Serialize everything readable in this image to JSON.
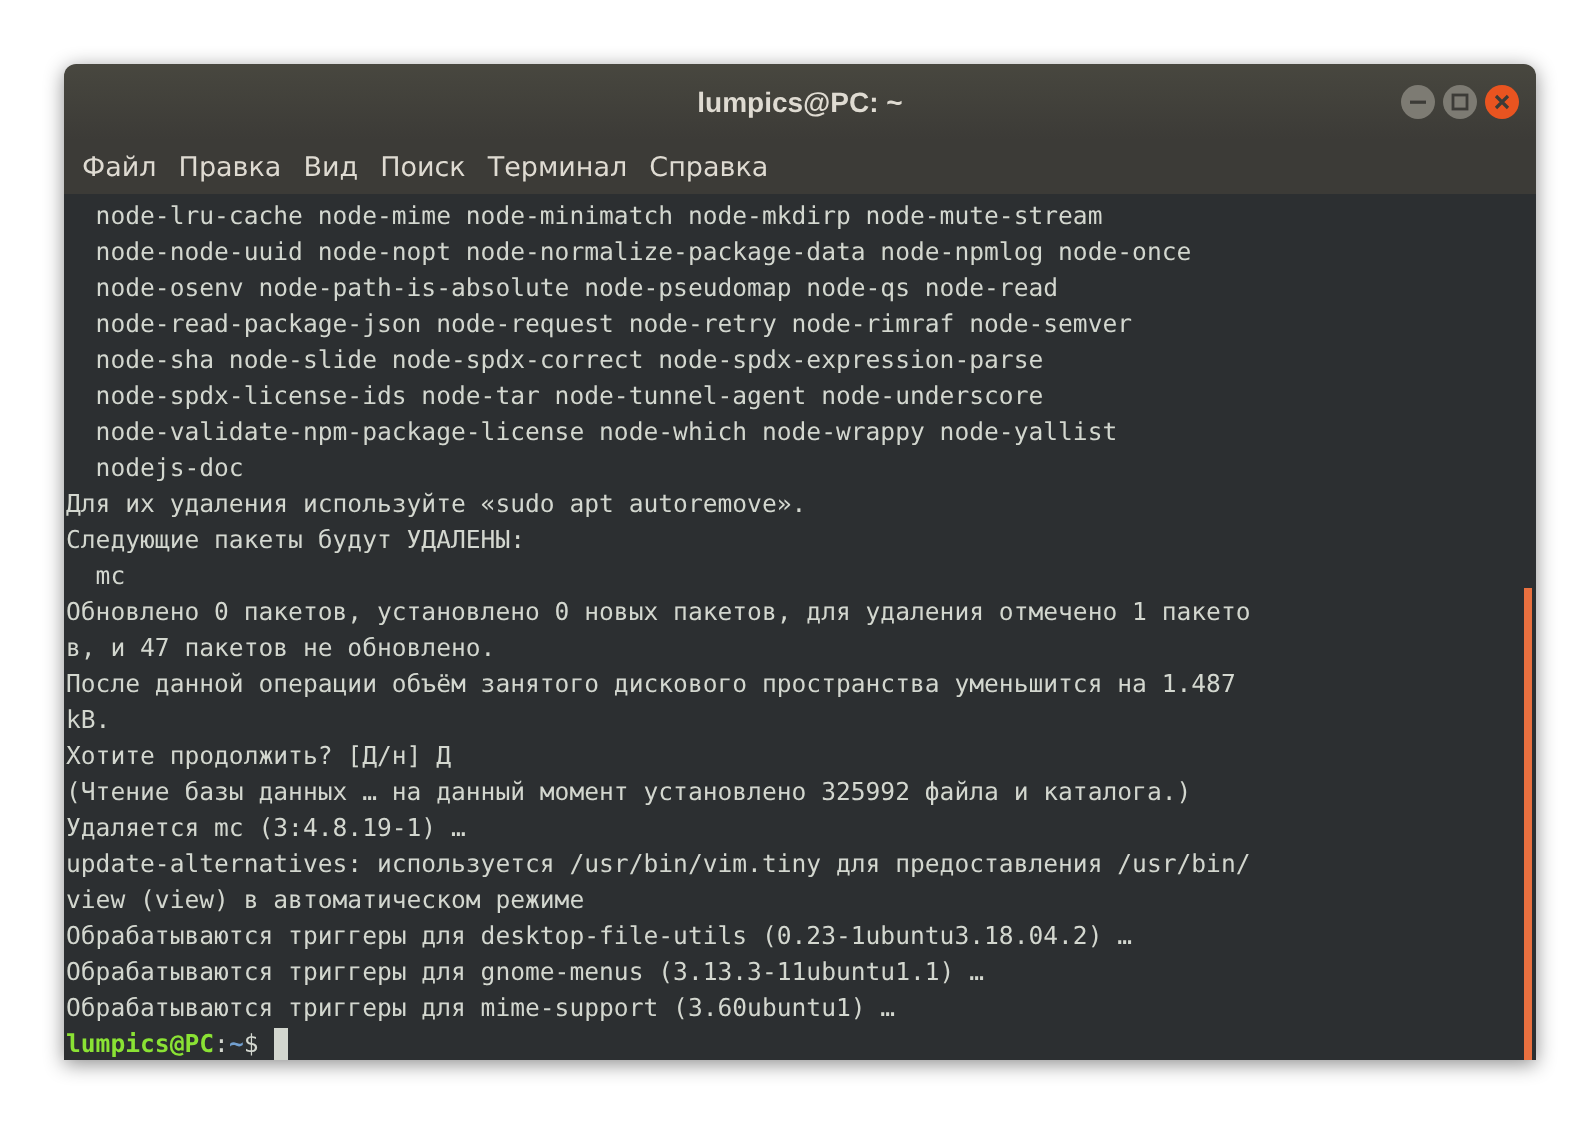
{
  "window": {
    "title": "lumpics@PC: ~"
  },
  "menu": [
    "Файл",
    "Правка",
    "Вид",
    "Поиск",
    "Терминал",
    "Справка"
  ],
  "terminal": {
    "lines": [
      {
        "kind": "text",
        "text": "  node-lru-cache node-mime node-minimatch node-mkdirp node-mute-stream"
      },
      {
        "kind": "text",
        "text": "  node-node-uuid node-nopt node-normalize-package-data node-npmlog node-once"
      },
      {
        "kind": "text",
        "text": "  node-osenv node-path-is-absolute node-pseudomap node-qs node-read"
      },
      {
        "kind": "text",
        "text": "  node-read-package-json node-request node-retry node-rimraf node-semver"
      },
      {
        "kind": "text",
        "text": "  node-sha node-slide node-spdx-correct node-spdx-expression-parse"
      },
      {
        "kind": "text",
        "text": "  node-spdx-license-ids node-tar node-tunnel-agent node-underscore"
      },
      {
        "kind": "text",
        "text": "  node-validate-npm-package-license node-which node-wrappy node-yallist"
      },
      {
        "kind": "text",
        "text": "  nodejs-doc"
      },
      {
        "kind": "text",
        "text": "Для их удаления используйте «sudo apt autoremove»."
      },
      {
        "kind": "text",
        "text": "Следующие пакеты будут УДАЛЕНЫ:"
      },
      {
        "kind": "text",
        "text": "  mc"
      },
      {
        "kind": "text",
        "text": "Обновлено 0 пакетов, установлено 0 новых пакетов, для удаления отмечено 1 пакето"
      },
      {
        "kind": "text",
        "text": "в, и 47 пакетов не обновлено."
      },
      {
        "kind": "text",
        "text": "После данной операции объём занятого дискового пространства уменьшится на 1.487"
      },
      {
        "kind": "text",
        "text": "kB."
      },
      {
        "kind": "text",
        "text": "Хотите продолжить? [Д/н] Д"
      },
      {
        "kind": "text",
        "text": "(Чтение базы данных … на данный момент установлено 325992 файла и каталога.)"
      },
      {
        "kind": "text",
        "text": "Удаляется mc (3:4.8.19-1) …"
      },
      {
        "kind": "text",
        "text": "update-alternatives: используется /usr/bin/vim.tiny для предоставления /usr/bin/"
      },
      {
        "kind": "text",
        "text": "view (view) в автоматическом режиме"
      },
      {
        "kind": "text",
        "text": "Обрабатываются триггеры для desktop-file-utils (0.23-1ubuntu3.18.04.2) …"
      },
      {
        "kind": "text",
        "text": "Обрабатываются триггеры для gnome-menus (3.13.3-11ubuntu1.1) …"
      },
      {
        "kind": "text",
        "text": "Обрабатываются триггеры для mime-support (3.60ubuntu1) …"
      },
      {
        "kind": "prompt",
        "user_host": "lumpics@PC",
        "separator": ":",
        "path": "~",
        "symbol": "$"
      }
    ]
  }
}
